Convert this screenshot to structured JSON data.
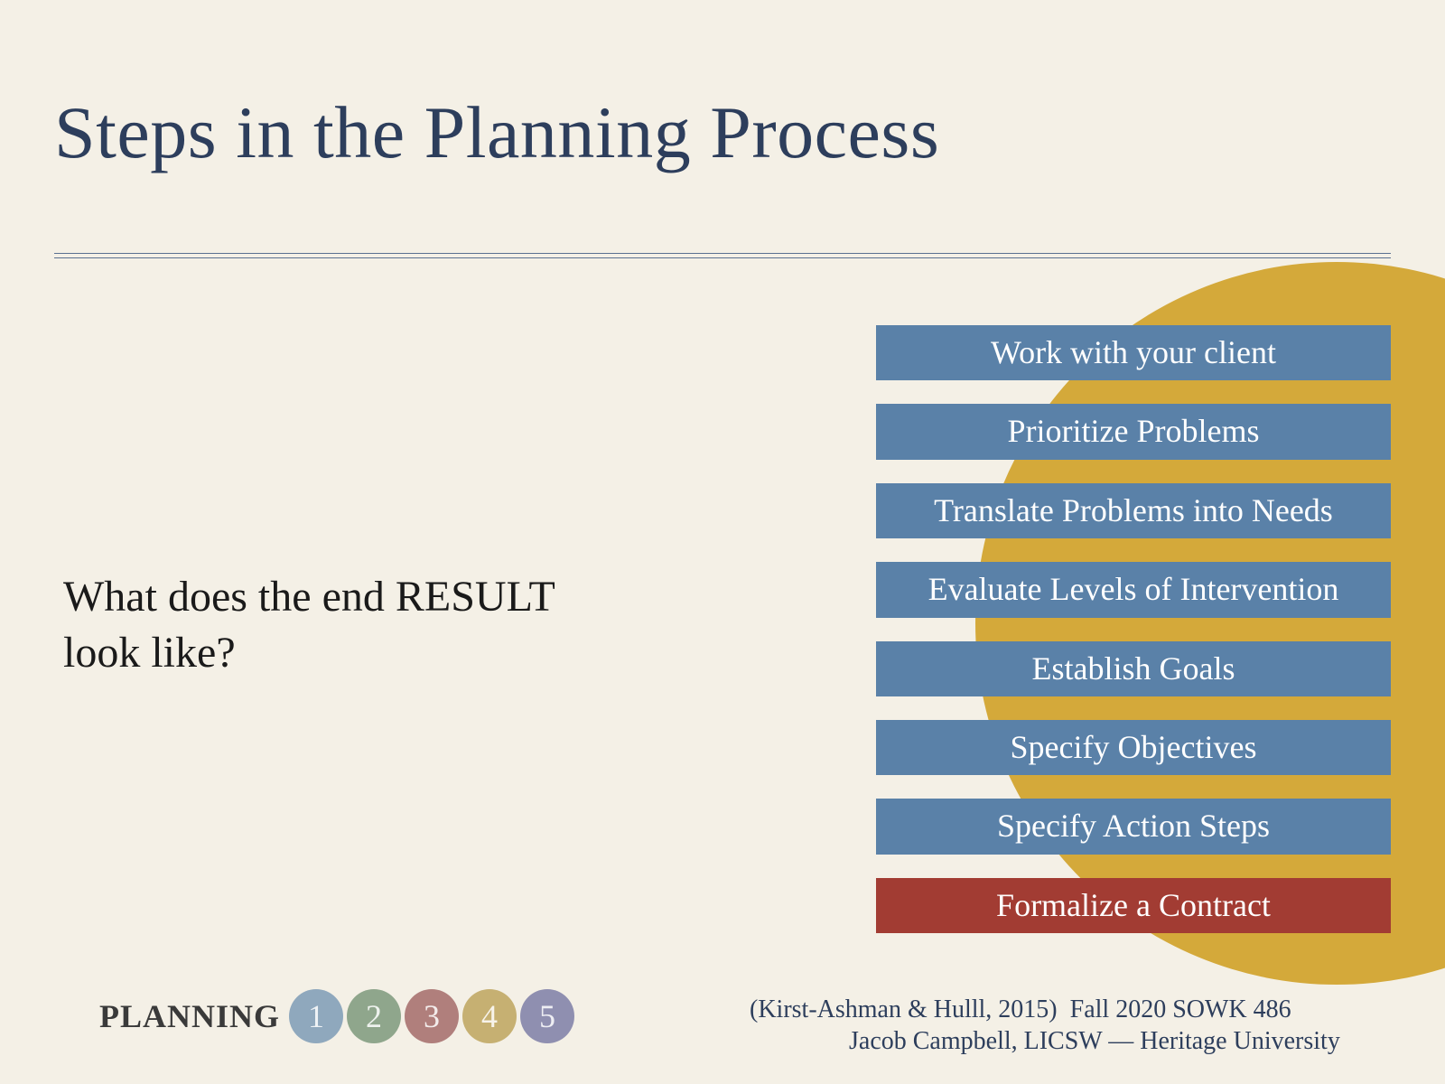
{
  "title": "Steps in the Planning Process",
  "subtitle_line1": "What does the end RESULT",
  "subtitle_line2": "look like?",
  "steps": [
    "Work with your client",
    "Prioritize Problems",
    "Translate Problems into Needs",
    "Evaluate Levels of Intervention",
    "Establish Goals",
    "Specify Objectives",
    "Specify Action Steps",
    "Formalize a Contract"
  ],
  "highlight_index": 7,
  "footer": {
    "label": "PLANNING",
    "pages": [
      "1",
      "2",
      "3",
      "4",
      "5"
    ],
    "citation": "(Kirst-Ashman & Hulll, 2015)",
    "term": "Fall 2020 SOWK 486",
    "author": "Jacob Campbell, LICSW — Heritage University"
  }
}
